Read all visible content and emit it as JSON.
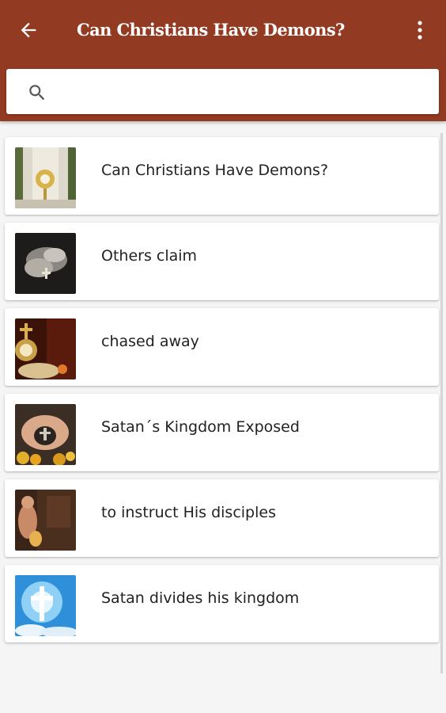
{
  "appbar": {
    "title": "Can Christians Have Demons?",
    "back_icon": "arrow-back-icon",
    "menu_icon": "more-vert-icon",
    "color": "#933a22"
  },
  "search": {
    "icon": "search-icon",
    "placeholder": "",
    "value": ""
  },
  "items": [
    {
      "label": "Can Christians Have Demons?",
      "thumb": "monstrance-altar-image"
    },
    {
      "label": "Others claim",
      "thumb": "hands-rosary-image"
    },
    {
      "label": "chased away",
      "thumb": "golden-monstrance-image"
    },
    {
      "label": "Satan´s Kingdom Exposed",
      "thumb": "hands-holding-cross-image"
    },
    {
      "label": "to instruct His disciples",
      "thumb": "praying-woman-image"
    },
    {
      "label": "Satan divides his kingdom",
      "thumb": "cross-in-sky-image"
    }
  ]
}
